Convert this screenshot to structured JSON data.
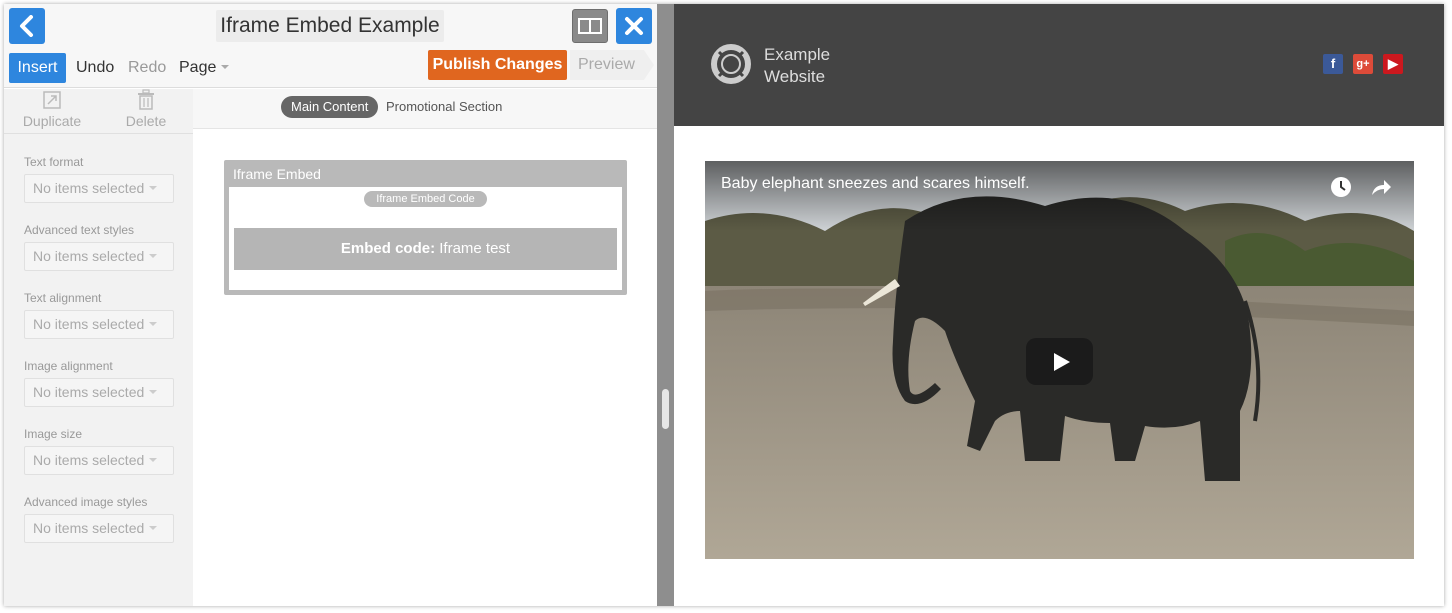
{
  "editor": {
    "title": "Iframe Embed Example",
    "menu": {
      "insert": "Insert",
      "undo": "Undo",
      "redo": "Redo",
      "page": "Page",
      "publish": "Publish Changes",
      "preview": "Preview"
    },
    "tools": {
      "duplicate": "Duplicate",
      "delete": "Delete"
    },
    "fields": [
      {
        "label": "Text format",
        "value": "No items selected"
      },
      {
        "label": "Advanced text styles",
        "value": "No items selected"
      },
      {
        "label": "Text alignment",
        "value": "No items selected"
      },
      {
        "label": "Image alignment",
        "value": "No items selected"
      },
      {
        "label": "Image size",
        "value": "No items selected"
      },
      {
        "label": "Advanced image styles",
        "value": "No items selected"
      }
    ],
    "sections": {
      "main": "Main Content",
      "promo": "Promotional Section"
    },
    "block": {
      "title": "Iframe Embed",
      "pill": "Iframe Embed Code",
      "code_label": "Embed code:",
      "code_value": " Iframe test"
    }
  },
  "site": {
    "name_line1": "Example",
    "name_line2": "Website",
    "social": {
      "facebook": "f",
      "googleplus": "g+",
      "youtube": "▶"
    },
    "video_title": "Baby elephant sneezes and scares himself."
  },
  "colors": {
    "accent_blue": "#2e86de",
    "publish_orange": "#e0661f",
    "site_header": "#444444"
  }
}
